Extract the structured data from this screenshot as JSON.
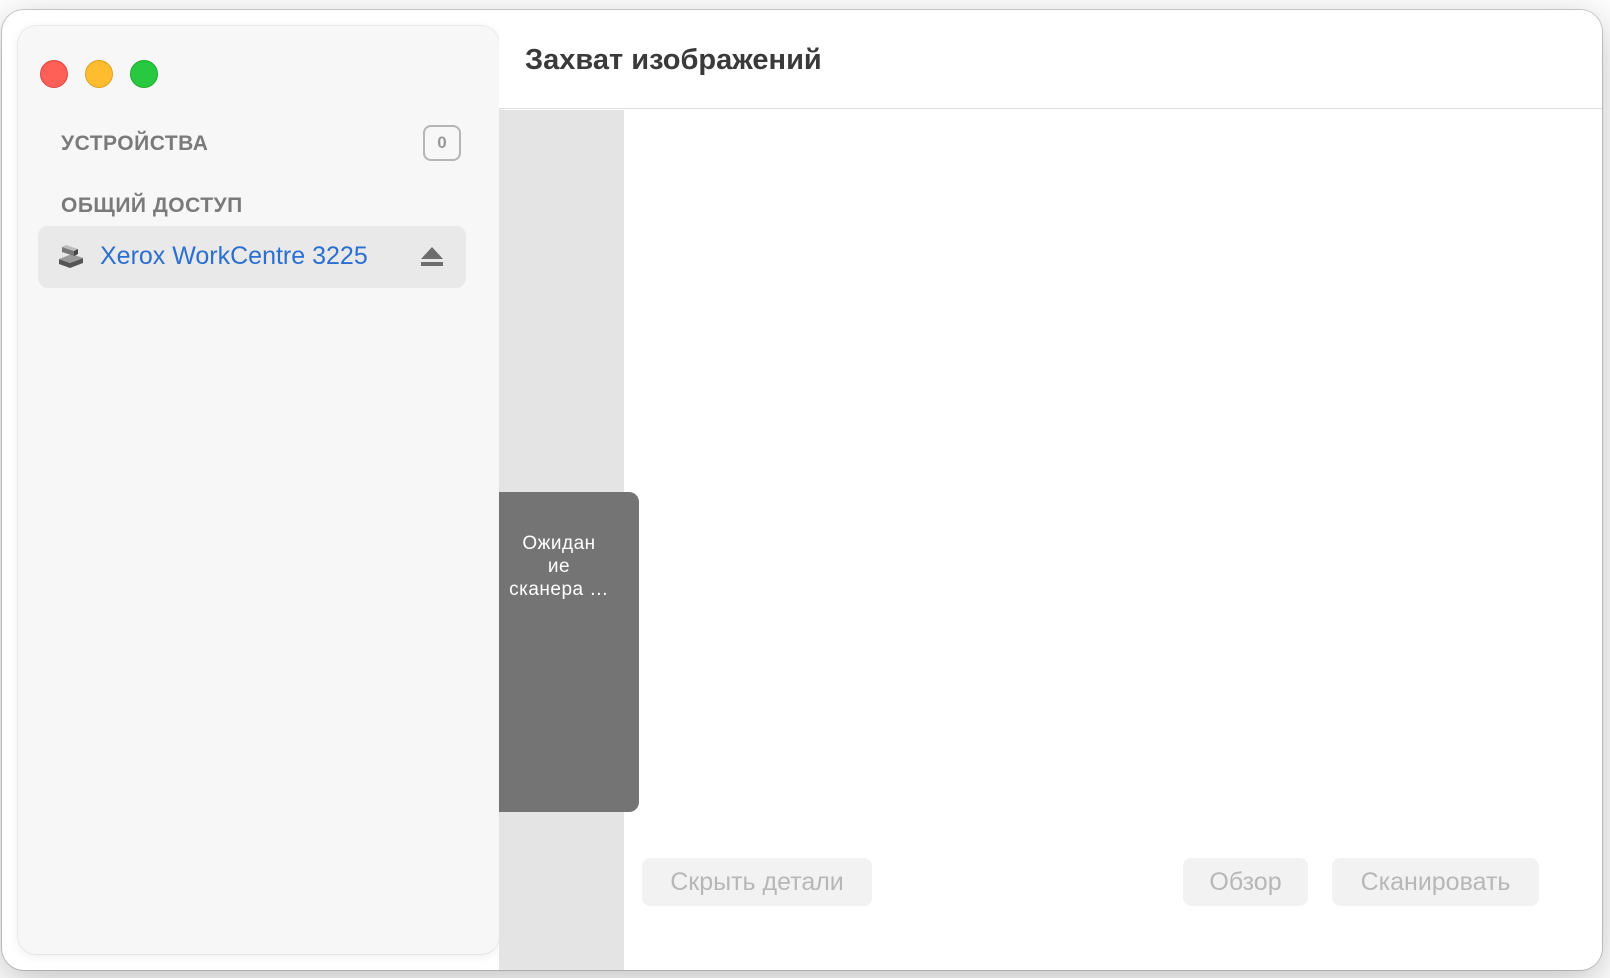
{
  "window": {
    "title": "Захват изображений"
  },
  "sidebar": {
    "devices_title": "УСТРОЙСТВА",
    "devices_count": "0",
    "shared_title": "ОБЩИЙ ДОСТУП",
    "shared_items": [
      {
        "label": "Xerox WorkCentre 3225",
        "icon": "scanner-icon",
        "action_icon": "eject-icon"
      }
    ]
  },
  "status": {
    "waiting_text": "Ожидан ие сканера …"
  },
  "footer": {
    "hide_details_label": "Скрыть детали",
    "browse_label": "Обзор",
    "scan_label": "Сканировать"
  },
  "colors": {
    "accent_link": "#2a6fd1",
    "close": "#fe5f57",
    "minimize": "#febc2e",
    "maximize": "#28c840"
  }
}
